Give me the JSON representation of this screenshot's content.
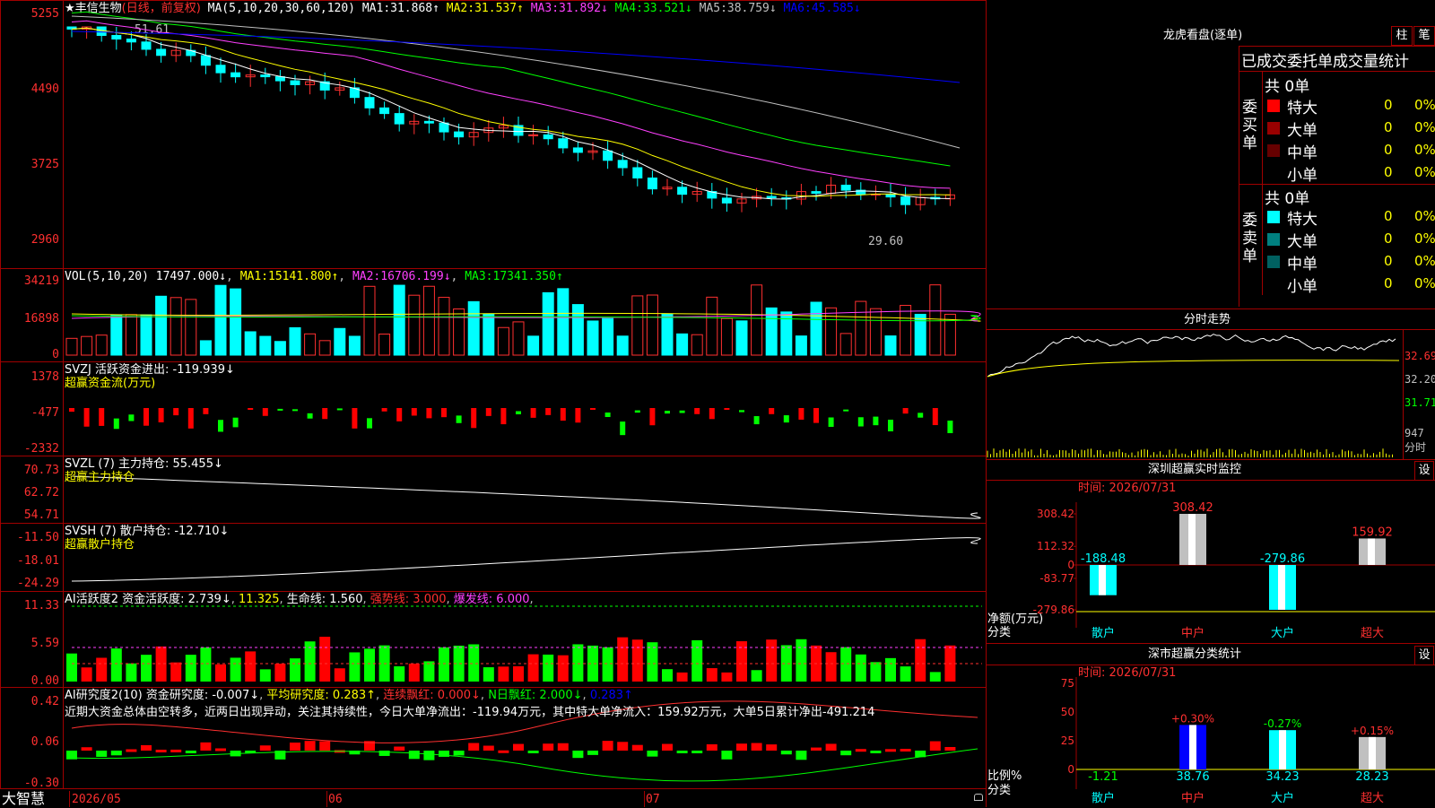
{
  "stock": {
    "name": "★丰信生物",
    "mode": "(日线，前复权)",
    "ma_label": "MA(5,10,20,30,60,120)",
    "ma": [
      {
        "label": "MA1:",
        "value": "31.868↑",
        "color": "#ffffff"
      },
      {
        "label": "MA2:",
        "value": "31.537↑",
        "color": "#ffff00"
      },
      {
        "label": "MA3:",
        "value": "31.892↓",
        "color": "#ff40ff"
      },
      {
        "label": "MA4:",
        "value": "33.521↓",
        "color": "#00ff00"
      },
      {
        "label": "MA5:",
        "value": "38.759↓",
        "color": "#c0c0c0"
      },
      {
        "label": "MA6:",
        "value": "45.585↓",
        "color": "#0000ff"
      }
    ],
    "high_label": "51.61",
    "low_label": "29.60",
    "yticks": [
      "5255",
      "4490",
      "3725",
      "2960"
    ]
  },
  "vol": {
    "title": "VOL(5,10,20)",
    "value": "17497.000↓",
    "ma": [
      {
        "t": "MA1:",
        "v": "15141.800↑",
        "c": "#ffff00"
      },
      {
        "t": "MA2:",
        "v": "16706.199↓",
        "c": "#ff40ff"
      },
      {
        "t": "MA3:",
        "v": "17341.350↑",
        "c": "#00ff00"
      }
    ],
    "yticks": [
      "34219",
      "16898",
      "0"
    ]
  },
  "svzj": {
    "title": "SVZJ  活跃资金进出: -119.939↓",
    "sub": "超赢资金流(万元)",
    "yticks": [
      "1378",
      "-477",
      "-2332"
    ]
  },
  "svzl": {
    "title": "SVZL (7) 主力持仓: 55.455↓",
    "sub": "超赢主力持仓",
    "yticks": [
      "70.73",
      "62.72",
      "54.71"
    ]
  },
  "svsh": {
    "title": "SVSH (7) 散户持仓: -12.710↓",
    "sub": "超赢散户持仓",
    "yticks": [
      "-11.50",
      "-18.01",
      "-24.29"
    ]
  },
  "ai1": {
    "title": "AI活跃度2 资金活跃度: 2.739↓",
    "v2": "11.325",
    "v3": "生命线: 1.560",
    "v4": "强势线: 3.000",
    "v5": "爆发线: 6.000",
    "yticks": [
      "11.33",
      "5.59",
      "0.00"
    ]
  },
  "ai2": {
    "title": "AI研究度2(10) 资金研究度: -0.007↓",
    "v2": "平均研究度: 0.283↑",
    "v3": "连续飘红: 0.000↓",
    "v4": "N日飘红: 2.000↓",
    "v5": "0.283↑",
    "comment": "近期大资金总体由空转多，近两日出现异动，关注其持续性，今日大单净流出：-119.94万元，其中特大单净流入：159.92万元，大单5日累计净出-491.214",
    "yticks": [
      "0.42",
      "0.06",
      "-0.30"
    ]
  },
  "footer": {
    "brand": "大智慧",
    "dates": [
      "2026/05",
      "06",
      "07"
    ]
  },
  "lhb": {
    "title": "龙虎看盘(逐单)",
    "btn1": "柱",
    "btn2": "笔",
    "header": "已成交委托单成交量统计",
    "buy": {
      "side": "委买单",
      "total": "共 0单",
      "rows": [
        {
          "label": "特大",
          "n": "0",
          "p": "0%",
          "c": "#ff0000"
        },
        {
          "label": "大单",
          "n": "0",
          "p": "0%",
          "c": "#990000"
        },
        {
          "label": "中单",
          "n": "0",
          "p": "0%",
          "c": "#660000"
        },
        {
          "label": "小单",
          "n": "0",
          "p": "0%",
          "c": "#000000"
        }
      ]
    },
    "sell": {
      "side": "委卖单",
      "total": "共 0单",
      "rows": [
        {
          "label": "特大",
          "n": "0",
          "p": "0%",
          "c": "#00ffff"
        },
        {
          "label": "大单",
          "n": "0",
          "p": "0%",
          "c": "#008080"
        },
        {
          "label": "中单",
          "n": "0",
          "p": "0%",
          "c": "#006060"
        },
        {
          "label": "小单",
          "n": "0",
          "p": "0%",
          "c": "#000000"
        }
      ]
    }
  },
  "fenshi": {
    "title": "分时走势",
    "prices": [
      "32.69",
      "32.20",
      "31.71"
    ],
    "vol": "947",
    "vol_unit": "分时"
  },
  "szmon": {
    "title": "深圳超赢实时监控",
    "btn": "设",
    "time": "时间: 2026/07/31",
    "yticks": [
      "308.42",
      "112.32",
      "0",
      "-83.77",
      "-279.86"
    ],
    "ylabel1": "净额(万元)",
    "ylabel2": "分类",
    "bars": [
      {
        "cat": "散户",
        "value": -188.48,
        "label": "-188.48",
        "color": "#00ffff"
      },
      {
        "cat": "中户",
        "value": 308.42,
        "label": "308.42",
        "color": "#c0c0c0"
      },
      {
        "cat": "大户",
        "value": -279.86,
        "label": "-279.86",
        "color": "#00ffff"
      },
      {
        "cat": "超大",
        "value": 159.92,
        "label": "159.92",
        "color": "#c0c0c0"
      }
    ]
  },
  "szcls": {
    "title": "深市超赢分类统计",
    "btn": "设",
    "time": "时间: 2026/07/31",
    "yticks": [
      "75",
      "50",
      "25",
      "0"
    ],
    "ylabel1": "比例%",
    "ylabel2": "分类",
    "bars": [
      {
        "cat": "散户",
        "value": 1.21,
        "label": "-1.21",
        "pct": "",
        "color": "#00ffff"
      },
      {
        "cat": "中户",
        "value": 38.76,
        "label": "38.76",
        "pct": "+0.30%",
        "color": "#0000ff"
      },
      {
        "cat": "大户",
        "value": 34.23,
        "label": "34.23",
        "pct": "-0.27%",
        "color": "#00ffff"
      },
      {
        "cat": "超大",
        "value": 28.23,
        "label": "28.23",
        "pct": "+0.15%",
        "color": "#c0c0c0"
      }
    ]
  }
}
